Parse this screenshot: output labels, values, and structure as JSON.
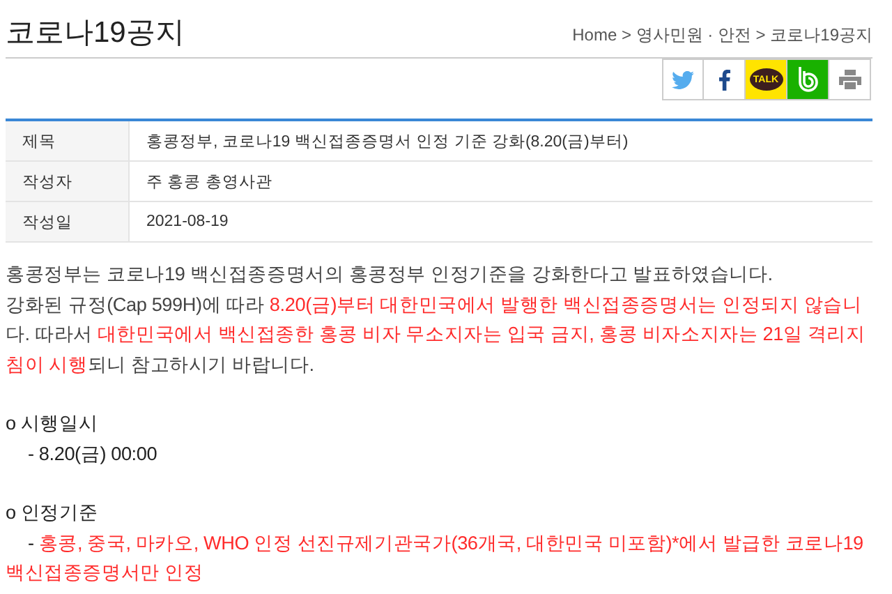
{
  "page_title": "코로나19공지",
  "breadcrumb": "Home > 영사민원 · 안전 > 코로나19공지",
  "share_buttons": [
    {
      "kind": "twitter"
    },
    {
      "kind": "facebook"
    },
    {
      "kind": "kakao",
      "label": "TALK"
    },
    {
      "kind": "band"
    },
    {
      "kind": "print"
    }
  ],
  "info": [
    {
      "label": "제목",
      "value": "홍콩정부, 코로나19 백신접종증명서 인정 기준 강화(8.20(금)부터)"
    },
    {
      "label": "작성자",
      "value": "주 홍콩 총영사관"
    },
    {
      "label": "작성일",
      "value": "2021-08-19"
    }
  ],
  "body": [
    {
      "kind": "paragraph",
      "segments": [
        {
          "text": "홍콩정부는 코로나19 백신접종증명서의 홍콩정부 인정기준을 강화한다고 발표하였습니다.",
          "highlight": false
        }
      ]
    },
    {
      "kind": "paragraph",
      "segments": [
        {
          "text": "강화된 규정(Cap 599H)에 따라 ",
          "highlight": false
        },
        {
          "text": "8.20(금)부터 대한민국에서 발행한 백신접종증명서는 인정되지 않습니",
          "highlight": true
        },
        {
          "text": "다. 따라서 ",
          "highlight": false
        },
        {
          "text": "대한민국에서 백신접종한 홍콩 비자 무소지자는 입국 금지, 홍콩 비자소지자는 21일 격리지침이 시행",
          "highlight": true
        },
        {
          "text": "되니 참고하시기 바랍니다.",
          "highlight": false
        }
      ]
    },
    {
      "kind": "heading",
      "segments": [
        {
          "text": "o 시행일시",
          "highlight": false
        }
      ]
    },
    {
      "kind": "detail",
      "segments": [
        {
          "text": "- 8.20(금) 00:00",
          "highlight": false
        }
      ]
    },
    {
      "kind": "heading",
      "segments": [
        {
          "text": "o 인정기준",
          "highlight": false
        }
      ]
    },
    {
      "kind": "detail",
      "segments": [
        {
          "text": "- ",
          "highlight": false
        },
        {
          "text": "홍콩, 중국, 마카오, WHO 인정 선진규제기관국가(36개국, 대한민국 미포함)*에서 발급한 코로나19 백신접종증명서만 인정",
          "highlight": true
        }
      ]
    }
  ]
}
